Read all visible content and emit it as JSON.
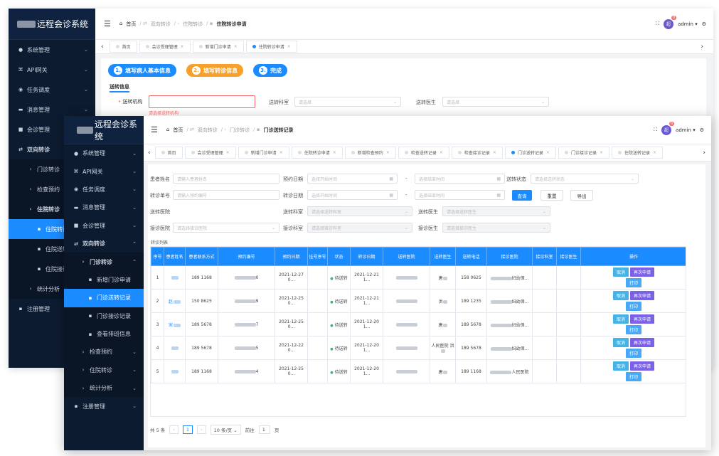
{
  "colors": {
    "sidebar": "#0d1b30",
    "accent": "#1b8cff",
    "step1": "#1b8cff",
    "step2": "#f7a12a",
    "danger": "#f56c6c"
  },
  "app": {
    "title": "远程会诊系统",
    "user": "admin",
    "badge": "0",
    "avatar": "超"
  },
  "back": {
    "breadcrumb": [
      "首页",
      "双向转诊",
      "住院转诊",
      "住院转诊申请"
    ],
    "tabs": [
      "首页",
      "会诊受理管理",
      "新增门诊申请",
      "住院转诊申请"
    ],
    "menu": [
      {
        "icon": "●",
        "label": "系统管理"
      },
      {
        "icon": "⌘",
        "label": "API网关"
      },
      {
        "icon": "◉",
        "label": "任务调度"
      },
      {
        "icon": "▬",
        "label": "消息管理"
      },
      {
        "icon": "■",
        "label": "会诊管理"
      },
      {
        "icon": "⇄",
        "label": "双向转诊"
      },
      {
        "icon": "›",
        "label": "门诊转诊"
      },
      {
        "icon": "›",
        "label": "检查预约"
      },
      {
        "icon": "›",
        "label": "住院转诊"
      },
      {
        "icon": "▪",
        "label": "住院转诊"
      },
      {
        "icon": "▪",
        "label": "住院送转"
      },
      {
        "icon": "▪",
        "label": "住院接诊"
      },
      {
        "icon": "›",
        "label": "统计分析"
      },
      {
        "icon": "▪",
        "label": "注册管理"
      }
    ],
    "steps": [
      "1.",
      "填写病人基本信息",
      "2.",
      "填写转诊信息",
      "3.",
      "完成"
    ],
    "section": "送转信息",
    "form": {
      "label1": "送转机构",
      "label2": "送转科室",
      "label3": "送转医生",
      "placeholder": "请选择",
      "error": "请选择送转机构",
      "required": "•"
    }
  },
  "front": {
    "breadcrumb": [
      "首页",
      "双向转诊",
      "门诊转诊",
      "门诊送转记录"
    ],
    "tabs": [
      "首页",
      "会诊受理管理",
      "新增门诊申请",
      "住院转诊申请",
      "新增检查预约",
      "检查送转记录",
      "检查接诊记录",
      "门诊送转记录",
      "门诊接诊记录",
      "住院送转记录"
    ],
    "menu": [
      {
        "icon": "●",
        "label": "系统管理"
      },
      {
        "icon": "⌘",
        "label": "API网关"
      },
      {
        "icon": "◉",
        "label": "任务调度"
      },
      {
        "icon": "▬",
        "label": "消息管理"
      },
      {
        "icon": "■",
        "label": "会诊管理"
      },
      {
        "icon": "⇄",
        "label": "双向转诊"
      },
      {
        "icon": "›",
        "label": "门诊转诊"
      },
      {
        "icon": "▪",
        "label": "新增门诊申请"
      },
      {
        "icon": "▪",
        "label": "门诊送转记录"
      },
      {
        "icon": "▪",
        "label": "门诊接诊记录"
      },
      {
        "icon": "▪",
        "label": "查看排班信息"
      },
      {
        "icon": "›",
        "label": "检查预约"
      },
      {
        "icon": "›",
        "label": "住院转诊"
      },
      {
        "icon": "›",
        "label": "统计分析"
      },
      {
        "icon": "▪",
        "label": "注册管理"
      }
    ],
    "filters": {
      "patient_name": "患者姓名",
      "patient_name_ph": "请输入患者姓名",
      "appt_date": "预约日期",
      "appt_start_ph": "选择开始时间",
      "appt_end_ph": "选择结束时间",
      "status": "送转状态",
      "status_ph": "请选择送转状态",
      "transfer_no": "转诊单号",
      "transfer_no_ph": "请输入预约编号",
      "transfer_date": "转诊日期",
      "tdate_start_ph": "选择开始时间",
      "tdate_end_ph": "选择结束时间",
      "dash": "-",
      "search": "查询",
      "reset": "重置",
      "export": "导出",
      "send_hosp": "送转医院",
      "send_dept": "送转科室",
      "send_dept_ph": "请选择送转科室",
      "send_doc": "送转医生",
      "send_doc_ph": "请选择送转医生",
      "recv_hosp": "接诊医院",
      "recv_hosp_ph": "请选择接诊医院",
      "recv_dept": "接诊科室",
      "recv_dept_ph": "请选择接诊科室",
      "recv_doc": "接诊医生",
      "recv_doc_ph": "请选择接诊医生"
    },
    "list_title": "转诊列表",
    "columns": [
      "序号",
      "患者姓名",
      "患者联系方式",
      "预约编号",
      "预约日期",
      "挂号序号",
      "状态",
      "转诊日期",
      "送转医院",
      "送转医生",
      "送转电话",
      "接诊医院",
      "接诊科室",
      "接诊医生",
      "操作"
    ],
    "rows": [
      {
        "no": "1",
        "name": "",
        "phone": "189 1168",
        "appt_no": "0",
        "date": "2021-12-27 0...",
        "status": "待送转",
        "tdate": "2021-12-21 1...",
        "doc": "唐",
        "tel": "158 0625",
        "recv": "妇幼保..."
      },
      {
        "no": "2",
        "name": "赵",
        "phone": "150 8625",
        "appt_no": "9",
        "date": "2021-12-25 0...",
        "status": "待送转",
        "tdate": "2021-12-21 1...",
        "doc": "洪",
        "tel": "189 1235",
        "recv": "妇幼保..."
      },
      {
        "no": "3",
        "name": "宋",
        "phone": "189 5678",
        "appt_no": "7",
        "date": "2021-12-25 0...",
        "status": "待送转",
        "tdate": "2021-12-20 1...",
        "doc": "唐",
        "tel": "189 5678",
        "recv": "妇幼保..."
      },
      {
        "no": "4",
        "name": "",
        "phone": "189 5678",
        "appt_no": "5",
        "date": "2021-12-22 0...",
        "status": "待送转",
        "tdate": "2021-12-20 1...",
        "doc": "人民医院 洪",
        "tel": "189 5678",
        "recv": "妇幼保..."
      },
      {
        "no": "5",
        "name": "",
        "phone": "189 1168",
        "appt_no": "4",
        "date": "2021-12-25 0...",
        "status": "待送转",
        "tdate": "2021-12-20 1...",
        "doc": "唐",
        "tel": "189 1168",
        "recv": "人民医院"
      }
    ],
    "actions": {
      "cancel": "取消",
      "reapply": "再次申请",
      "print": "打印"
    },
    "pager": {
      "total": "共 5 条",
      "page": "1",
      "size": "10 条/页",
      "goto": "前往",
      "goto_val": "1",
      "unit": "页"
    }
  }
}
